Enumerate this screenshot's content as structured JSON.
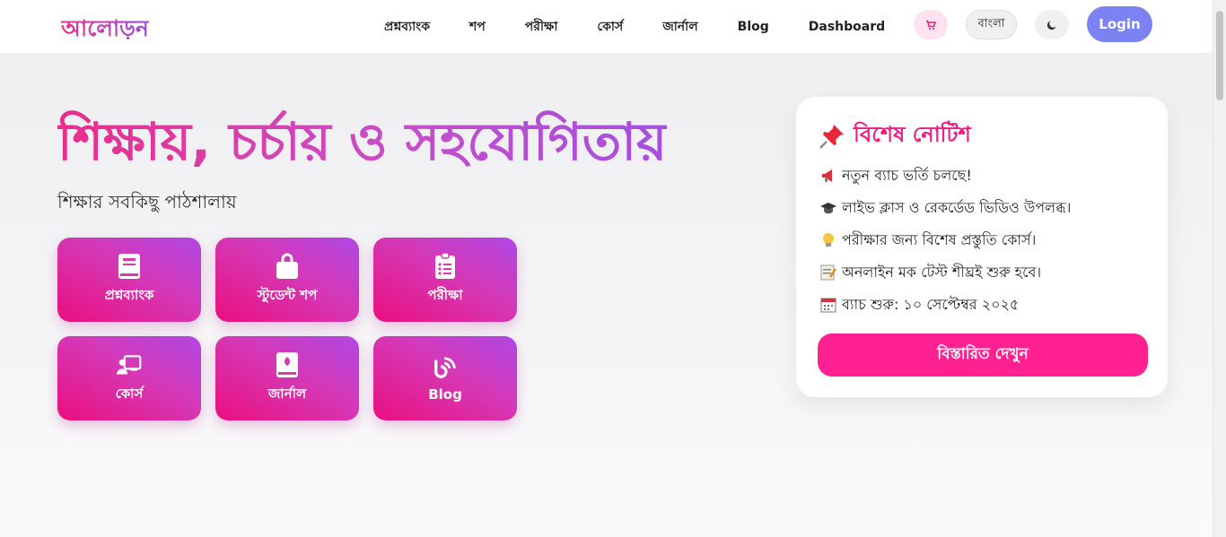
{
  "nav": {
    "brand": "আলোড়ন",
    "links": [
      "প্রশ্নব্যাংক",
      "শপ",
      "পরীক্ষা",
      "কোর্স",
      "জার্নাল",
      "Blog",
      "Dashboard"
    ],
    "language": "বাংলা",
    "login": "Login"
  },
  "hero": {
    "title": "শিক্ষায়, চর্চায় ও সহযোগিতায়",
    "subtitle": "শিক্ষার সবকিছু পাঠশালায়",
    "tiles": [
      {
        "label": "প্রশ্নব্যাংক",
        "icon": "book-icon"
      },
      {
        "label": "স্টুডেন্ট শপ",
        "icon": "shopping-bag-icon"
      },
      {
        "label": "পরীক্ষা",
        "icon": "clipboard-list-icon"
      },
      {
        "label": "কোর্স",
        "icon": "chalkboard-teacher-icon"
      },
      {
        "label": "জার্নাল",
        "icon": "journal-icon"
      },
      {
        "label": "Blog",
        "icon": "blog-icon"
      }
    ]
  },
  "notice": {
    "title": "বিশেষ নোটিশ",
    "icon": "pushpin-icon",
    "items": [
      {
        "icon": "megaphone-icon",
        "text": "নতুন ব্যাচ ভর্তি চলছে!"
      },
      {
        "icon": "graduation-cap-icon",
        "text": "লাইভ ক্লাস ও রেকর্ডেড ভিডিও উপলব্ধ।"
      },
      {
        "icon": "lightbulb-icon",
        "text": "পরীক্ষার জন্য বিশেষ প্রস্তুতি কোর্স।"
      },
      {
        "icon": "memo-icon",
        "text": "অনলাইন মক টেস্ট শীঘ্রই শুরু হবে।"
      },
      {
        "icon": "calendar-icon",
        "text": "ব্যাচ শুরু: ১০ সেপ্টেম্বর ২০২৫"
      }
    ],
    "button": "বিস্তারিত দেখুন"
  },
  "colors": {
    "accent_pink": "#ff2191",
    "login_blue": "#7b83f2",
    "tile_gradient_start": "#ea0f7e",
    "tile_gradient_end": "#b048e4"
  }
}
